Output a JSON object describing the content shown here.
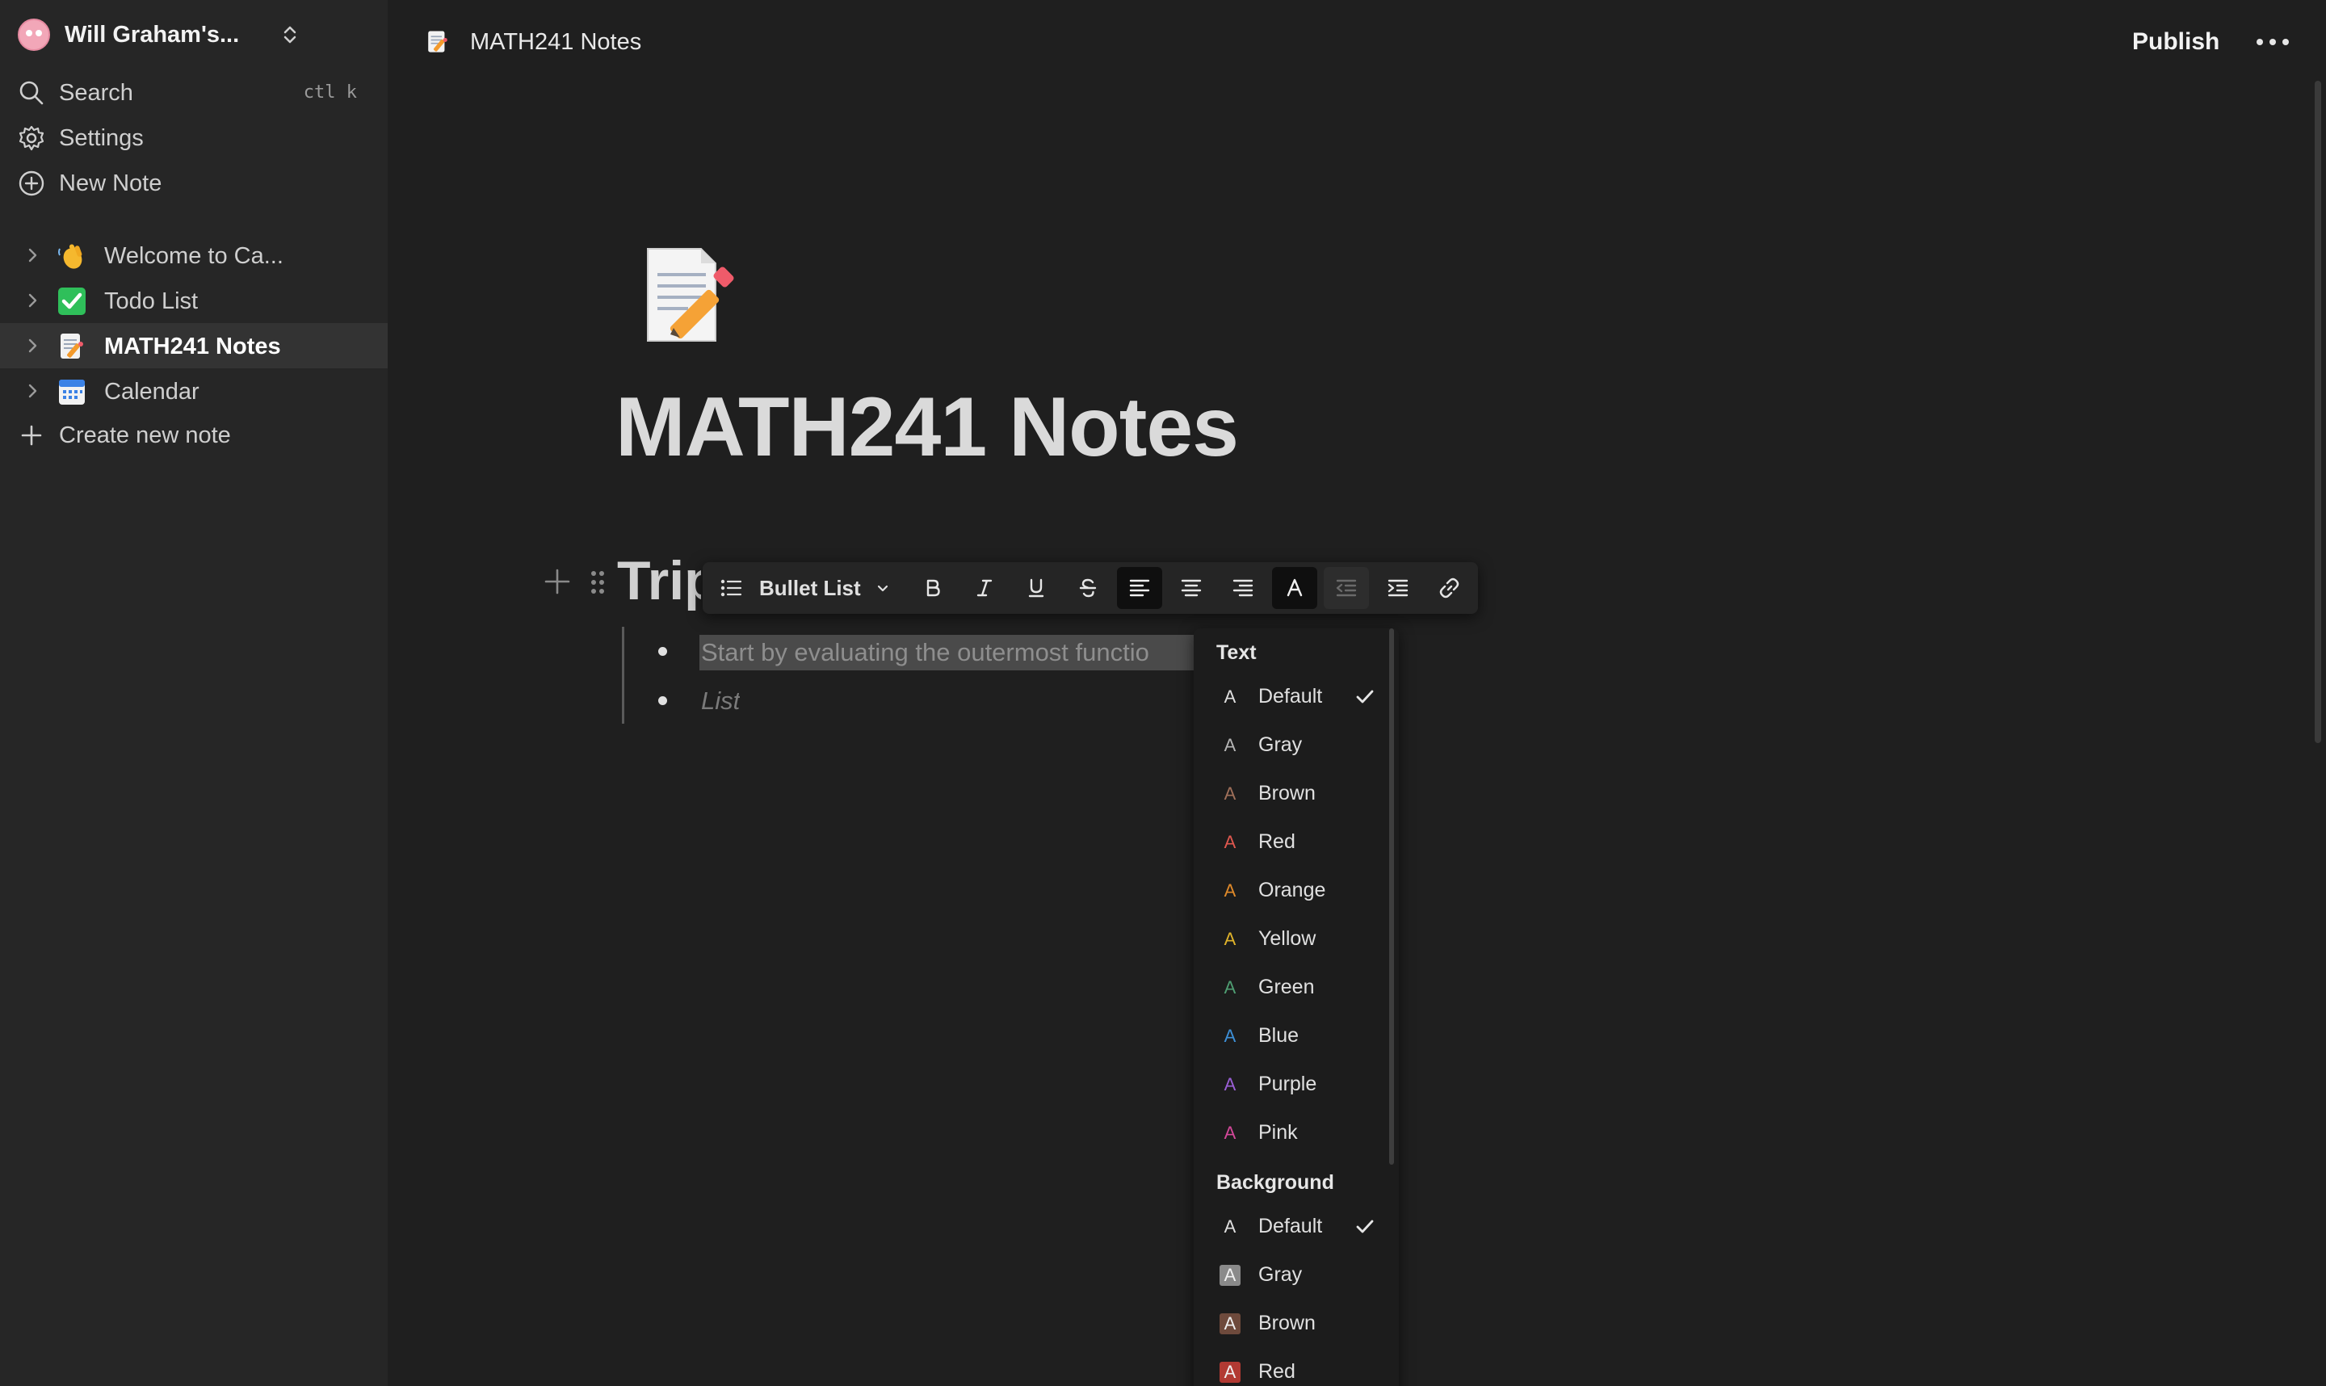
{
  "sidebar": {
    "workspace_name": "Will Graham's...",
    "actions": [
      {
        "label": "Search",
        "shortcut": "ctl k",
        "icon": "search-icon"
      },
      {
        "label": "Settings",
        "icon": "gear-icon"
      },
      {
        "label": "New Note",
        "icon": "plus-circle-icon"
      }
    ],
    "notes": [
      {
        "label": "Welcome to Ca...",
        "icon": "waving-hand-emoji"
      },
      {
        "label": "Todo List",
        "icon": "check-box-emoji"
      },
      {
        "label": "MATH241 Notes",
        "icon": "memo-emoji",
        "active": true
      },
      {
        "label": "Calendar",
        "icon": "calendar-emoji"
      }
    ],
    "create_label": "Create new note"
  },
  "topbar": {
    "page_title": "MATH241 Notes",
    "publish_label": "Publish"
  },
  "page": {
    "title": "MATH241 Notes",
    "heading_fragment": "Trip",
    "list_items": [
      {
        "text": "Start by evaluating the outermost functio",
        "selected": true
      },
      {
        "text": "List",
        "placeholder": true
      }
    ]
  },
  "toolbar": {
    "block_type": "Bullet List",
    "buttons": [
      "bold",
      "italic",
      "underline",
      "strikethrough",
      "align-left",
      "align-center",
      "align-right",
      "text-color",
      "outdent",
      "indent",
      "link"
    ],
    "active": "align-left"
  },
  "color_menu": {
    "text_heading": "Text",
    "text_colors": [
      {
        "label": "Default",
        "color": "#e0e0e0",
        "checked": true
      },
      {
        "label": "Gray",
        "color": "#b5b5b5"
      },
      {
        "label": "Brown",
        "color": "#a0705a"
      },
      {
        "label": "Red",
        "color": "#e0584f"
      },
      {
        "label": "Orange",
        "color": "#e08a2a"
      },
      {
        "label": "Yellow",
        "color": "#e0b32a"
      },
      {
        "label": "Green",
        "color": "#4f9e72"
      },
      {
        "label": "Blue",
        "color": "#3d8fd6"
      },
      {
        "label": "Purple",
        "color": "#9a5fd6"
      },
      {
        "label": "Pink",
        "color": "#d4489a"
      }
    ],
    "background_heading": "Background",
    "background_colors": [
      {
        "label": "Default",
        "color": "",
        "checked": true
      },
      {
        "label": "Gray",
        "color": "#8a8a8a"
      },
      {
        "label": "Brown",
        "color": "#6e4a3c"
      },
      {
        "label": "Red",
        "color": "#b23a33"
      }
    ]
  }
}
